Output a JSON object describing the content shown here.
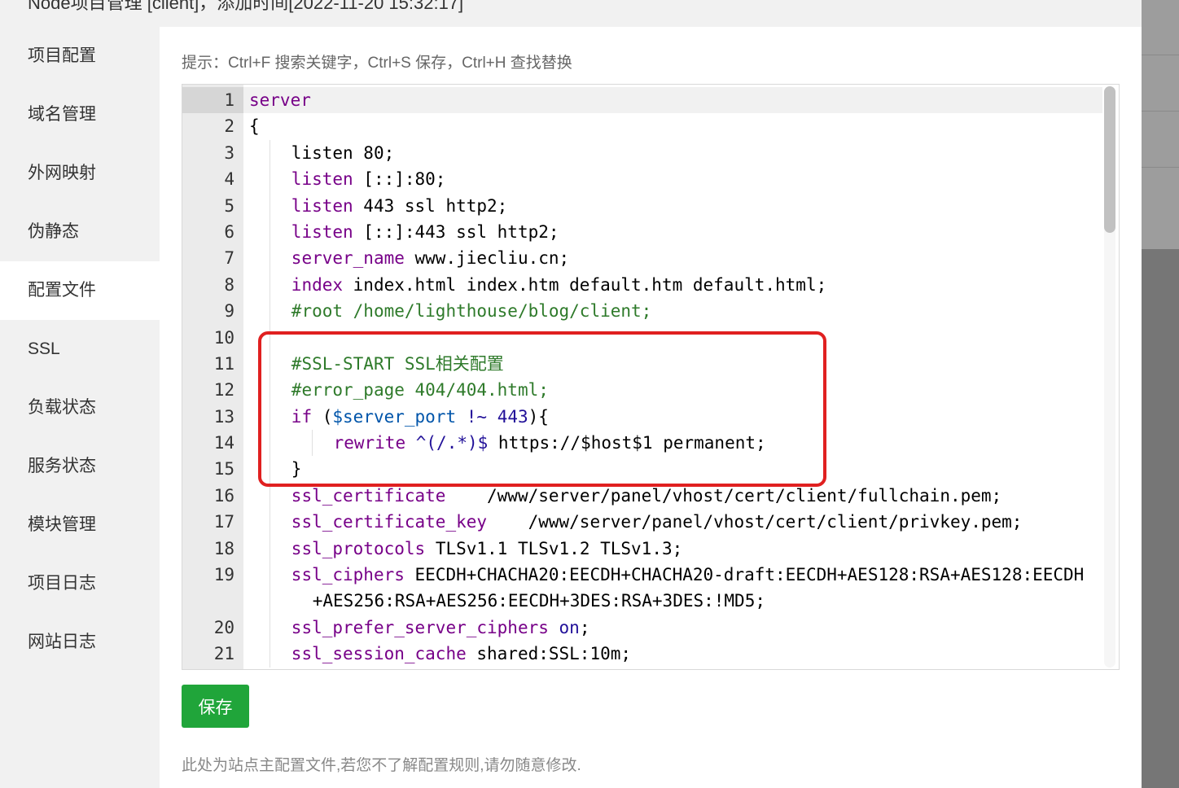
{
  "window": {
    "title": "Node项目管理 [client]，添加时间[2022-11-20 15:32:17]"
  },
  "sidebar": {
    "items": [
      {
        "label": "项目配置",
        "active": false
      },
      {
        "label": "域名管理",
        "active": false
      },
      {
        "label": "外网映射",
        "active": false
      },
      {
        "label": "伪静态",
        "active": false
      },
      {
        "label": "配置文件",
        "active": true
      },
      {
        "label": "SSL",
        "active": false
      },
      {
        "label": "负载状态",
        "active": false
      },
      {
        "label": "服务状态",
        "active": false
      },
      {
        "label": "模块管理",
        "active": false
      },
      {
        "label": "项目日志",
        "active": false
      },
      {
        "label": "网站日志",
        "active": false
      }
    ]
  },
  "editor": {
    "tip": "提示：Ctrl+F 搜索关键字，Ctrl+S 保存，Ctrl+H 查找替换",
    "lines": [
      {
        "n": "1",
        "indent": 0,
        "parts": [
          {
            "t": "server",
            "c": "kw"
          }
        ]
      },
      {
        "n": "2",
        "indent": 0,
        "parts": [
          {
            "t": "{",
            "c": ""
          }
        ]
      },
      {
        "n": "3",
        "indent": 1,
        "parts": [
          {
            "t": "listen 80;",
            "c": ""
          }
        ]
      },
      {
        "n": "4",
        "indent": 1,
        "parts": [
          {
            "t": "listen",
            "c": "kw"
          },
          {
            "t": " [::]:80;",
            "c": ""
          }
        ]
      },
      {
        "n": "5",
        "indent": 1,
        "parts": [
          {
            "t": "listen",
            "c": "kw"
          },
          {
            "t": " 443 ssl http2;",
            "c": ""
          }
        ]
      },
      {
        "n": "6",
        "indent": 1,
        "parts": [
          {
            "t": "listen",
            "c": "kw"
          },
          {
            "t": " [::]:443 ssl http2;",
            "c": ""
          }
        ]
      },
      {
        "n": "7",
        "indent": 1,
        "parts": [
          {
            "t": "server_name",
            "c": "kw"
          },
          {
            "t": " www.jiecliu.cn;",
            "c": ""
          }
        ]
      },
      {
        "n": "8",
        "indent": 1,
        "parts": [
          {
            "t": "index",
            "c": "kw"
          },
          {
            "t": " index.html index.htm default.htm default.html;",
            "c": ""
          }
        ]
      },
      {
        "n": "9",
        "indent": 1,
        "parts": [
          {
            "t": "#root /home/lighthouse/blog/client;",
            "c": "cm"
          }
        ]
      },
      {
        "n": "10",
        "indent": 1,
        "parts": []
      },
      {
        "n": "11",
        "indent": 1,
        "parts": [
          {
            "t": "#SSL-START SSL相关配置",
            "c": "cm"
          }
        ]
      },
      {
        "n": "12",
        "indent": 1,
        "parts": [
          {
            "t": "#error_page 404/404.html;",
            "c": "cm"
          }
        ]
      },
      {
        "n": "13",
        "indent": 1,
        "parts": [
          {
            "t": "if",
            "c": "kw"
          },
          {
            "t": " (",
            "c": ""
          },
          {
            "t": "$server_port",
            "c": "vr"
          },
          {
            "t": " ",
            "c": ""
          },
          {
            "t": "!~",
            "c": "at"
          },
          {
            "t": " ",
            "c": ""
          },
          {
            "t": "443",
            "c": "at"
          },
          {
            "t": "){",
            "c": ""
          }
        ]
      },
      {
        "n": "14",
        "indent": 2,
        "parts": [
          {
            "t": "rewrite",
            "c": "kw"
          },
          {
            "t": " ",
            "c": ""
          },
          {
            "t": "^(/.*)$",
            "c": "at"
          },
          {
            "t": " https://$host$1 permanent;",
            "c": ""
          }
        ]
      },
      {
        "n": "15",
        "indent": 1,
        "parts": [
          {
            "t": "}",
            "c": ""
          }
        ]
      },
      {
        "n": "16",
        "indent": 1,
        "parts": [
          {
            "t": "ssl_certificate",
            "c": "kw"
          },
          {
            "t": "    /www/server/panel/vhost/cert/client/fullchain.pem;",
            "c": ""
          }
        ]
      },
      {
        "n": "17",
        "indent": 1,
        "parts": [
          {
            "t": "ssl_certificate_key",
            "c": "kw"
          },
          {
            "t": "    /www/server/panel/vhost/cert/client/privkey.pem;",
            "c": ""
          }
        ]
      },
      {
        "n": "18",
        "indent": 1,
        "parts": [
          {
            "t": "ssl_protocols",
            "c": "kw"
          },
          {
            "t": " TLSv1.1 TLSv1.2 TLSv1.3;",
            "c": ""
          }
        ]
      },
      {
        "n": "19",
        "indent": 1,
        "parts": [
          {
            "t": "ssl_ciphers",
            "c": "kw"
          },
          {
            "t": " EECDH+CHACHA20:EECDH+CHACHA20-draft:EECDH+AES128:RSA+AES128:EECDH",
            "c": ""
          }
        ],
        "wrap": [
          {
            "t": "+AES256:RSA+AES256:EECDH+3DES:RSA+3DES:!MD5;",
            "c": ""
          }
        ]
      },
      {
        "n": "20",
        "indent": 1,
        "parts": [
          {
            "t": "ssl_prefer_server_ciphers",
            "c": "kw"
          },
          {
            "t": " ",
            "c": ""
          },
          {
            "t": "on",
            "c": "at"
          },
          {
            "t": ";",
            "c": ""
          }
        ]
      },
      {
        "n": "21",
        "indent": 1,
        "parts": [
          {
            "t": "ssl_session_cache",
            "c": "kw"
          },
          {
            "t": " shared:SSL:10m;",
            "c": ""
          }
        ]
      }
    ]
  },
  "actions": {
    "save_label": "保存"
  },
  "footer": {
    "note": "此处为站点主配置文件,若您不了解配置规则,请勿随意修改."
  },
  "colors": {
    "save_button": "#20a53a",
    "highlight_box": "#e02020",
    "keyword": "#770088",
    "comment": "#2e7a2a",
    "variable": "#0055aa",
    "atom": "#221199"
  }
}
